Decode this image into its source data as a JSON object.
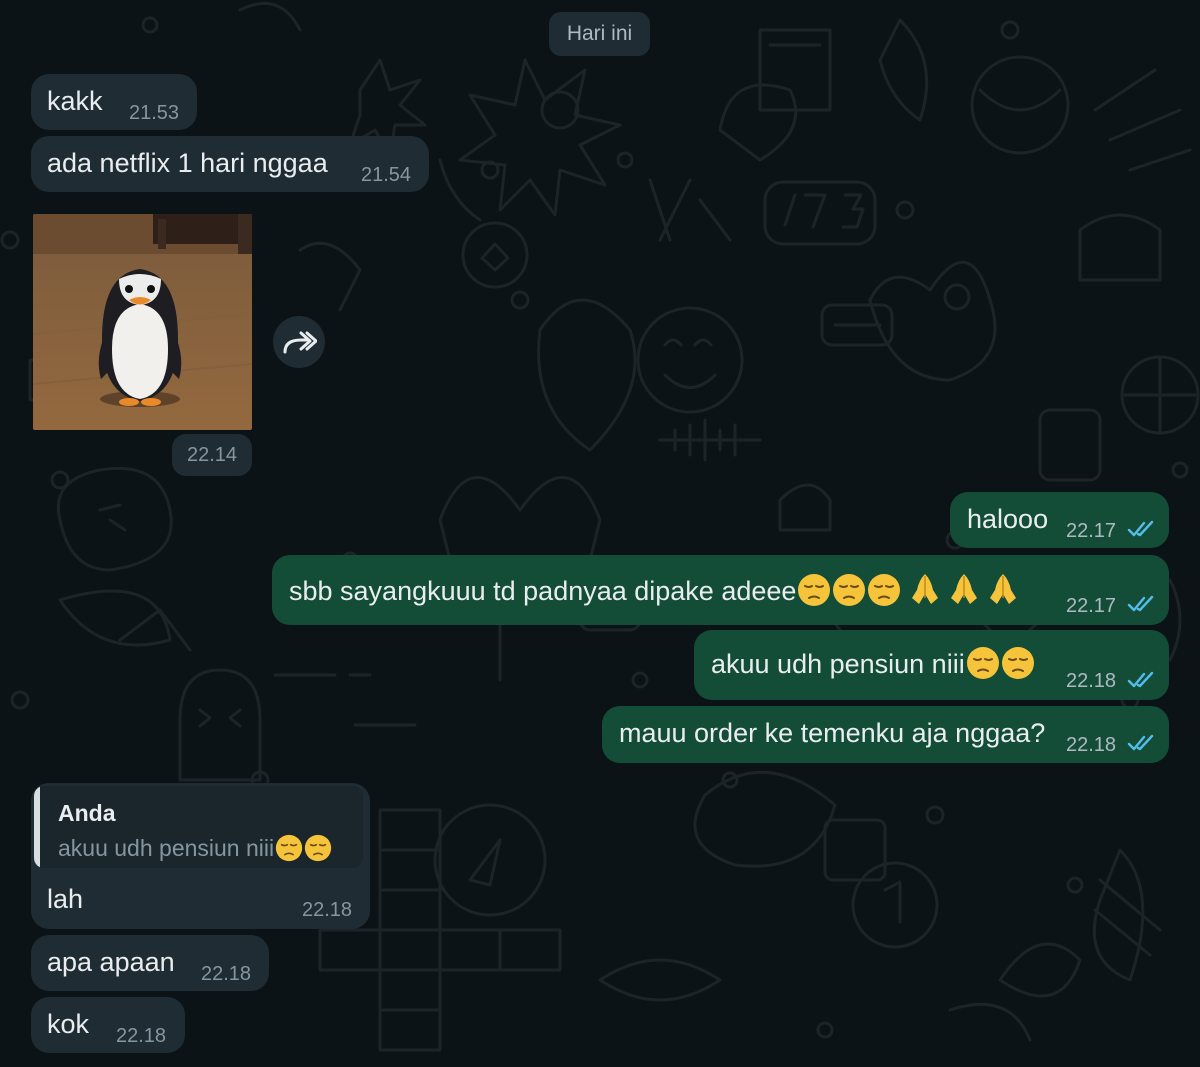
{
  "date_separator": "Hari ini",
  "messages": [
    {
      "text": "kakk",
      "time": "21.53"
    },
    {
      "text": "ada netflix 1 hari nggaa",
      "time": "21.54"
    },
    {
      "image": "penguin-sticker",
      "time": "22.14"
    },
    {
      "text": "halooo",
      "time": "22.17"
    },
    {
      "text": "sbb sayangkuuu td padnyaa dipake adeee",
      "emoji_suffix": "😔😔😔🙏🙏🙏",
      "time": "22.17"
    },
    {
      "text": "akuu udh pensiun niii",
      "emoji_suffix": "😔😔",
      "time": "22.18"
    },
    {
      "text": "mauu order ke temenku aja nggaa?",
      "time": "22.18"
    },
    {
      "quote_author": "Anda",
      "quote_text": "akuu udh pensiun niii",
      "quote_emoji": "😔😔",
      "text": "lah",
      "time": "22.18"
    },
    {
      "text": "apa apaan",
      "time": "22.18"
    },
    {
      "text": "kok",
      "time": "22.18"
    }
  ],
  "icons": {
    "forward": "forward-icon",
    "read_receipt": "double-check-icon",
    "sad_emoji": "pensive-face-icon",
    "pray_emoji": "folded-hands-icon"
  },
  "colors": {
    "background": "#0c1317",
    "incoming_bubble": "#1f2c34",
    "outgoing_bubble": "#144d37",
    "read_tick": "#53bdeb"
  }
}
